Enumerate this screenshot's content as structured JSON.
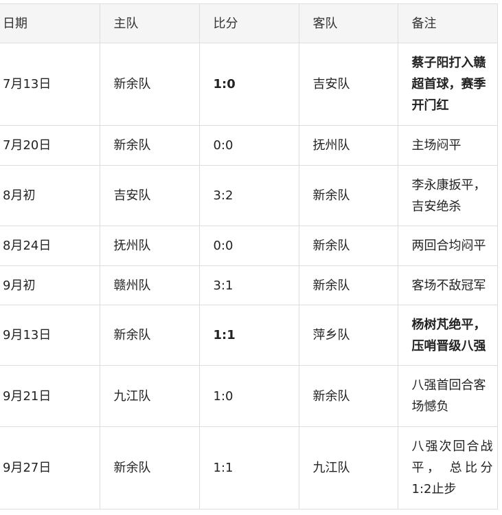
{
  "table": {
    "headers": [
      "日期",
      "主队",
      "比分",
      "客队",
      "备注"
    ],
    "rows": [
      {
        "date": "7月13日",
        "home": "新余队",
        "score": "1:0",
        "away": "吉安队",
        "note": "蔡子阳打入赣超首球，赛季开门红",
        "bold_score": true,
        "bold_note": true
      },
      {
        "date": "7月20日",
        "home": "新余队",
        "score": "0:0",
        "away": "抚州队",
        "note": "主场闷平"
      },
      {
        "date": "8月初",
        "home": "吉安队",
        "score": "3:2",
        "away": "新余队",
        "note": "李永康扳平，吉安绝杀"
      },
      {
        "date": "8月24日",
        "home": "抚州队",
        "score": "0:0",
        "away": "新余队",
        "note": "两回合均闷平"
      },
      {
        "date": "9月初",
        "home": "赣州队",
        "score": "3:1",
        "away": "新余队",
        "note": "客场不敌冠军"
      },
      {
        "date": "9月13日",
        "home": "新余队",
        "score": "1:1",
        "away": "萍乡队",
        "note": "杨树芃绝平，压哨晋级八强",
        "bold_score": true,
        "bold_note": true
      },
      {
        "date": "9月21日",
        "home": "九江队",
        "score": "1:0",
        "away": "新余队",
        "note": "八强首回合客场憾负"
      },
      {
        "date": "9月27日",
        "home": "新余队",
        "score": "1:1",
        "away": "九江队",
        "note": "八强次回合战平， 总比分1:2止步"
      }
    ]
  }
}
